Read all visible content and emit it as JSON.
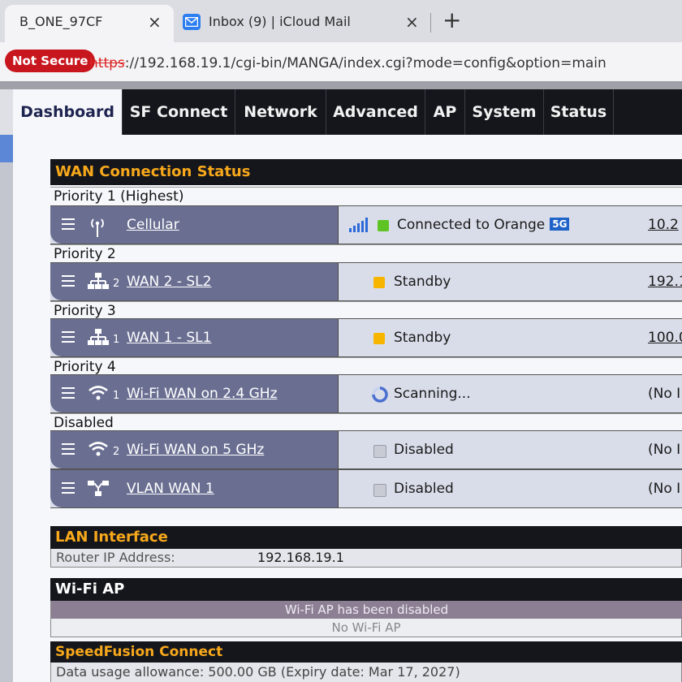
{
  "browser": {
    "tabs": [
      {
        "title": "B_ONE_97CF",
        "close": "×"
      },
      {
        "title": "Inbox (9) | iCloud Mail",
        "close": "×"
      }
    ],
    "new_tab": "+",
    "security_badge": "Not Secure",
    "url_scheme": "https",
    "url_rest": "://192.168.19.1/cgi-bin/MANGA/index.cgi?mode=config&option=main"
  },
  "nav": {
    "items": [
      "Dashboard",
      "SF Connect",
      "Network",
      "Advanced",
      "AP",
      "System",
      "Status"
    ],
    "active": "Dashboard"
  },
  "wan": {
    "title": "WAN Connection Status",
    "priorities": [
      "Priority 1 (Highest)",
      "Priority 2",
      "Priority 3",
      "Priority 4",
      "Disabled"
    ],
    "connections": [
      {
        "name": "Cellular",
        "icon": "cellular-antenna-icon",
        "sub": "",
        "status": "Connected to Orange",
        "badge": "5G",
        "status_color": "#5ec423",
        "ip": "10.2"
      },
      {
        "name": "WAN 2 - SL2",
        "icon": "ethernet-network-icon",
        "sub": "2",
        "status": "Standby",
        "status_color": "#f7b500",
        "ip": "192.1"
      },
      {
        "name": "WAN 1 - SL1",
        "icon": "ethernet-network-icon",
        "sub": "1",
        "status": "Standby",
        "status_color": "#f7b500",
        "ip": "100.0"
      },
      {
        "name": "Wi-Fi WAN on 2.4 GHz",
        "icon": "wifi-icon",
        "sub": "1",
        "status": "Scanning...",
        "status_color": "#5a7ed6",
        "ip": "(No I"
      },
      {
        "name": "Wi-Fi WAN on 5 GHz",
        "icon": "wifi-icon",
        "sub": "2",
        "status": "Disabled",
        "status_color": "#c8cad4",
        "ip": "(No I"
      },
      {
        "name": "VLAN WAN 1",
        "icon": "vlan-icon",
        "sub": "",
        "status": "Disabled",
        "status_color": "#c8cad4",
        "ip": "(No I"
      }
    ]
  },
  "lan": {
    "title": "LAN Interface",
    "label": "Router IP Address:",
    "value": "192.168.19.1"
  },
  "wifi_ap": {
    "title": "Wi-Fi AP",
    "message": "Wi-Fi AP has been disabled",
    "sub": "No Wi-Fi AP"
  },
  "speedfusion": {
    "title": "SpeedFusion Connect",
    "usage": "Data usage allowance: 500.00 GB (Expiry date: Mar 17, 2027)"
  }
}
